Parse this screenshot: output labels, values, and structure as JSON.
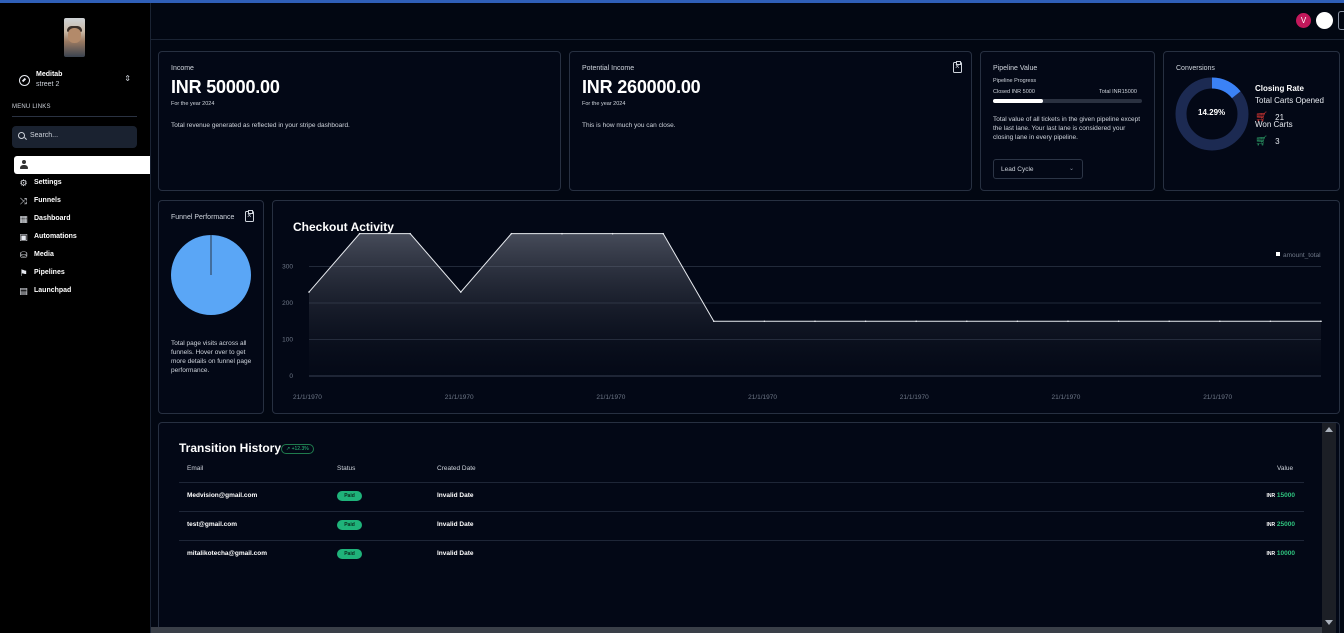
{
  "sidebar": {
    "account_name": "Meditab",
    "account_sub": "street 2",
    "menu_heading": "MENU LINKS",
    "search_placeholder": "Search...",
    "items": [
      {
        "label": "Settings",
        "icon": "gear-icon"
      },
      {
        "label": "Funnels",
        "icon": "shuffle-icon"
      },
      {
        "label": "Dashboard",
        "icon": "grid-icon"
      },
      {
        "label": "Automations",
        "icon": "chip-icon"
      },
      {
        "label": "Media",
        "icon": "database-icon"
      },
      {
        "label": "Pipelines",
        "icon": "flag-icon"
      },
      {
        "label": "Launchpad",
        "icon": "clipboard-icon"
      }
    ]
  },
  "header": {
    "user_initial": "V"
  },
  "income": {
    "title": "Income",
    "amount": "INR 50000.00",
    "period": "For the year 2024",
    "description": "Total revenue generated as reflected in your stripe dashboard."
  },
  "potential_income": {
    "title": "Potential Income",
    "amount": "INR 260000.00",
    "period": "For the year 2024",
    "description": "This is how much you can close."
  },
  "pipeline_value": {
    "title": "Pipeline Value",
    "progress_label": "Pipeline Progress",
    "closed_label": "Closed INR 5000",
    "total_label": "Total INR15000",
    "progress_fraction": 0.3333,
    "description": "Total value of all tickets in the given pipeline except the last lane. Your last lane is considered your closing lane in every pipeline.",
    "select_value": "Lead Cycle"
  },
  "conversions": {
    "title": "Conversions",
    "rate_text": "14.29%",
    "rate_fraction": 0.1429,
    "closing_rate_label": "Closing Rate",
    "total_carts_label": "Total Carts Opened",
    "total_carts_value": "21",
    "won_carts_label": "Won Carts",
    "won_carts_value": "3",
    "colors": {
      "ring": "#1c2a52",
      "arc": "#3b82f6"
    }
  },
  "funnel_performance": {
    "title": "Funnel Performance",
    "description": "Total page visits across all funnels. Hover over to get more details on funnel page performance.",
    "pie_color": "#5aa6f6"
  },
  "checkout_activity": {
    "title": "Checkout Activity"
  },
  "chart_data": {
    "type": "area",
    "legend": [
      "amount_total"
    ],
    "legend_placement": "top-right",
    "yticks": [
      "0",
      "100",
      "200",
      "300"
    ],
    "ylim": [
      0,
      400
    ],
    "xtick_labels": [
      "21/1/1970",
      "21/1/1970",
      "21/1/1970",
      "21/1/1970",
      "21/1/1970",
      "21/1/1970",
      "21/1/1970"
    ],
    "series": [
      {
        "name": "amount_total",
        "values": [
          230,
          390,
          390,
          230,
          390,
          390,
          390,
          390,
          150,
          150,
          150,
          150,
          150,
          150,
          150,
          150,
          150,
          150,
          150,
          150,
          150
        ]
      }
    ],
    "grid": true
  },
  "transition_history": {
    "title": "Transition History",
    "change_badge": "+12.3%",
    "columns": [
      "Email",
      "Status",
      "Created Date",
      "Value"
    ],
    "rows": [
      {
        "email": "Medvision@gmail.com",
        "status": "Paid",
        "date": "Invalid Date",
        "currency": "INR",
        "value": "15000"
      },
      {
        "email": "test@gmail.com",
        "status": "Paid",
        "date": "Invalid Date",
        "currency": "INR",
        "value": "25000"
      },
      {
        "email": "mitalikotecha@gmail.com",
        "status": "Paid",
        "date": "Invalid Date",
        "currency": "INR",
        "value": "10000"
      }
    ]
  }
}
